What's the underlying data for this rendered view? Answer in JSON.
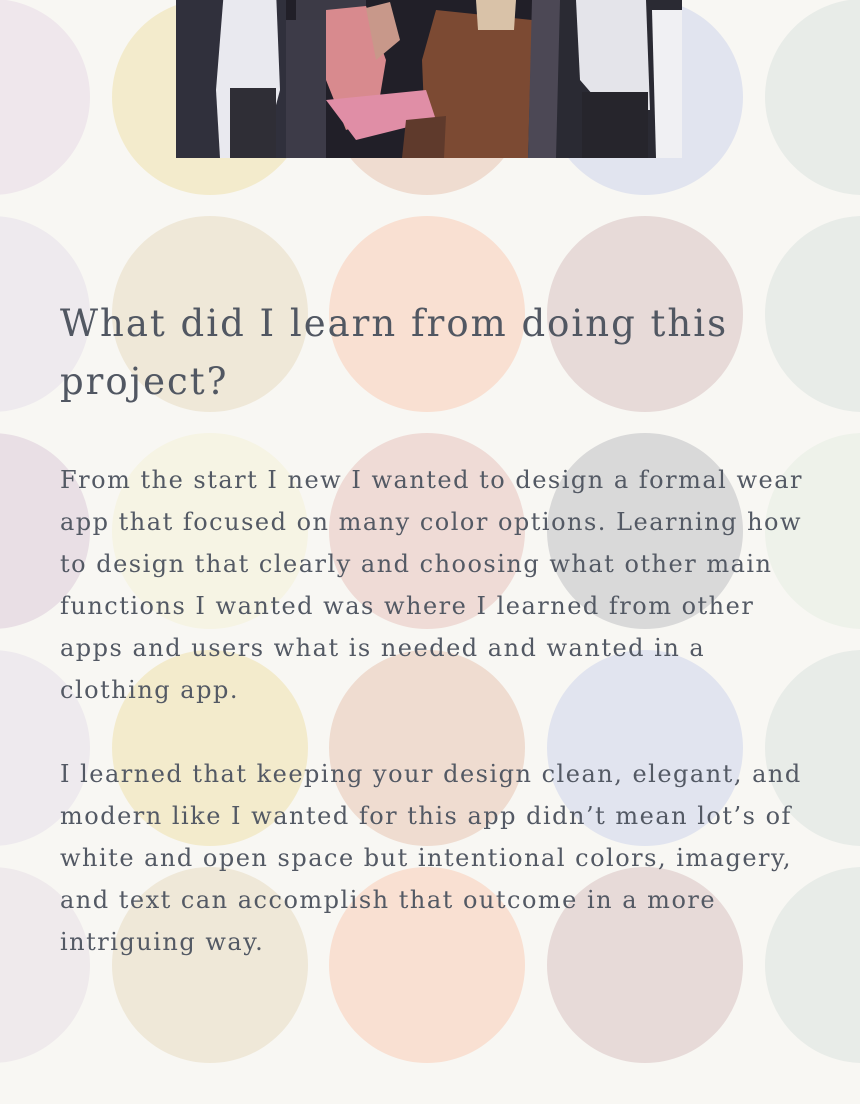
{
  "image": {
    "alt": "Dancing couples at a formal event"
  },
  "section": {
    "heading": "What did I learn from doing this project?",
    "paragraphs": [
      "From the start I new I wanted to design a formal wear app that focused on many color options. Learning how to design that clearly and choosing what other main functions I wanted was where I learned from other apps and users what is needed and wanted in a clothing app.",
      "I learned that keeping your design clean, elegant, and modern like I wanted for this app didn’t mean lot’s of white and open space but intentional colors, imagery, and text can accomplish that outcome in a more intriguing way."
    ]
  },
  "background": {
    "page_color": "#f8f7f3",
    "dot_rows": [
      [
        "#eadfe3",
        "#f7f3de",
        "#efd9d3",
        "#d8d8d8",
        "#eef2ea"
      ],
      [
        "#efe7ec",
        "#f3ebcc",
        "#efdcd0",
        "#e1e4ef",
        "#e8ece8"
      ],
      [
        "#eeeaee",
        "#efe8d8",
        "#f9e0d2",
        "#e7dad8",
        "#e8ece8"
      ],
      [
        "#e9dfe5",
        "#f6f4e4",
        "#efdbd6",
        "#d9d9d9",
        "#eef2ea"
      ],
      [
        "#eeeaee",
        "#f3ebcc",
        "#efdcd0",
        "#e1e4ef",
        "#e8ece8"
      ],
      [
        "#efeaec",
        "#efe8d8",
        "#f9e0d2",
        "#e7dad8",
        "#e8ece8"
      ]
    ]
  }
}
